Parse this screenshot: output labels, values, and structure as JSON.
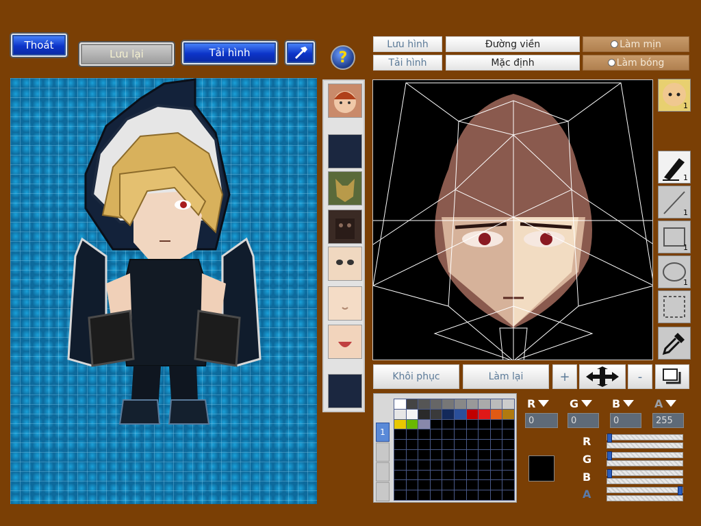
{
  "toolbar": {
    "exit_label": "Thoát",
    "save_label": "Lưu lại",
    "load_label": "Tải hình",
    "help_label": "?"
  },
  "editor": {
    "save_image_label": "Lưu hình",
    "load_image_label": "Tải hình",
    "outline_label": "Đường viền",
    "default_label": "Mặc định",
    "smooth_label": "Làm mịn",
    "shine_label": "Làm bóng"
  },
  "tools": {
    "face_badge": "1",
    "pen_count": "1",
    "line_count": "1",
    "rect_count": "1",
    "ellipse_count": "1"
  },
  "actions": {
    "restore_label": "Khôi phục",
    "redo_label": "Làm lại",
    "plus_label": "+",
    "minus_label": "-"
  },
  "color": {
    "r_label": "R",
    "g_label": "G",
    "b_label": "B",
    "a_label": "A",
    "r_value": "0",
    "g_value": "0",
    "b_value": "0",
    "a_value": "255",
    "current_color": "#000000",
    "r_level": 0,
    "g_level": 0,
    "b_level": 0,
    "a_level": 1,
    "palette_tab": "1",
    "palette": [
      "#ffffff",
      "#444444",
      "#555555",
      "#666666",
      "#777777",
      "#888888",
      "#999999",
      "#aaaaaa",
      "#bbbbbb",
      "#cccccc",
      "#e6e6e6",
      "#f4f4f4",
      "#2a2a2a",
      "#3a3a3a",
      "#13295a",
      "#2a4f9a",
      "#c00000",
      "#e01818",
      "#e05a14",
      "#b07a10",
      "#e8c800",
      "#6ab800",
      "#8888aa"
    ]
  }
}
